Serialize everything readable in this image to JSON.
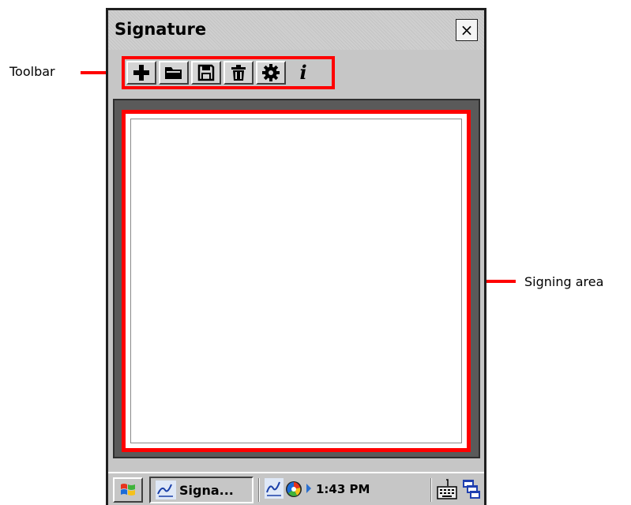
{
  "window": {
    "title": "Signature",
    "close_glyph": "×"
  },
  "toolbar": {
    "buttons": [
      {
        "name": "new",
        "icon": "plus-icon"
      },
      {
        "name": "open",
        "icon": "folder-icon"
      },
      {
        "name": "save",
        "icon": "floppy-disk-icon"
      },
      {
        "name": "delete",
        "icon": "trash-icon"
      },
      {
        "name": "settings",
        "icon": "gear-icon"
      },
      {
        "name": "info",
        "icon": "info-icon",
        "glyph": "i"
      }
    ]
  },
  "taskbar": {
    "task_label": "Signa...",
    "clock": "1:43 PM"
  },
  "annotations": {
    "toolbar_label": "Toolbar",
    "signing_area_label": "Signing area"
  },
  "colors": {
    "highlight": "#ff0000",
    "signing_frame": "#5a5a5a",
    "chrome": "#c6c6c6"
  }
}
